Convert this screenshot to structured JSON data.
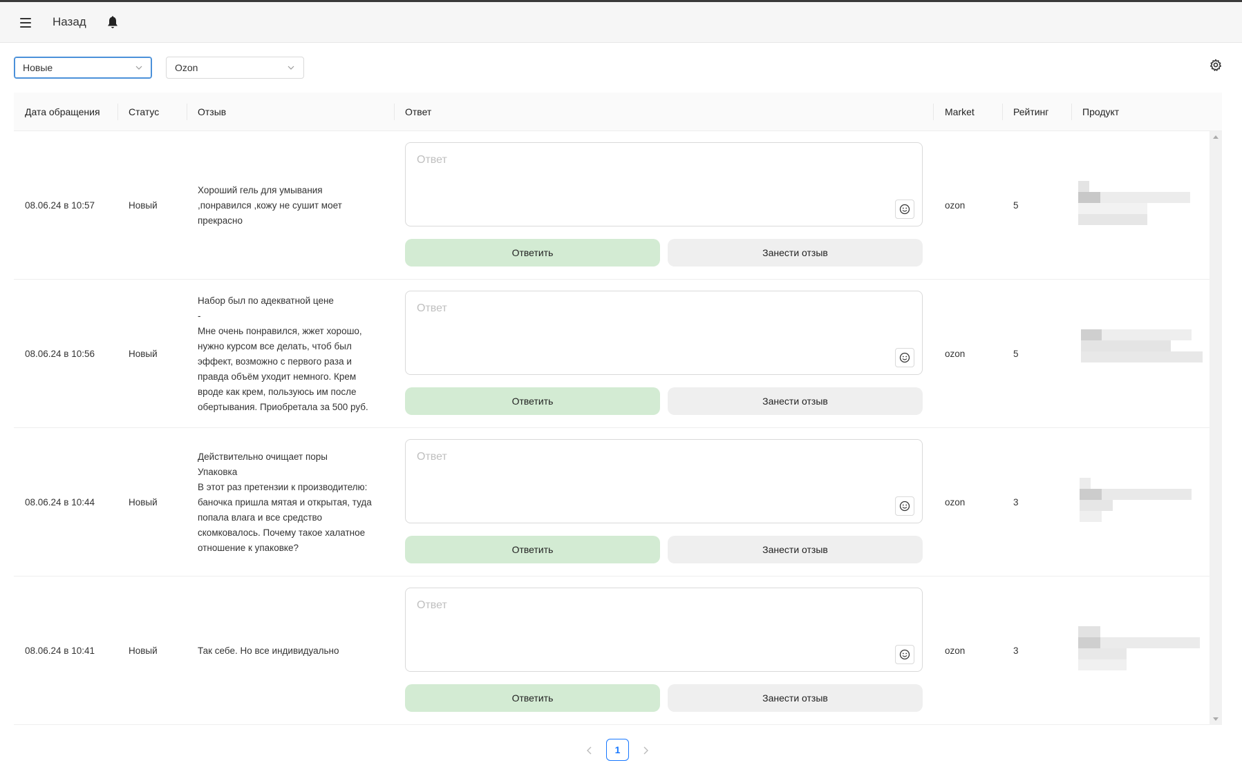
{
  "header": {
    "back_label": "Назад"
  },
  "filters": {
    "status_value": "Новые",
    "market_value": "Ozon"
  },
  "table": {
    "columns": {
      "date": "Дата обращения",
      "status": "Статус",
      "review": "Отзыв",
      "answer": "Ответ",
      "market": "Market",
      "rating": "Рейтинг",
      "product": "Продукт"
    },
    "answer_placeholder": "Ответ",
    "reply_label": "Ответить",
    "save_label": "Занести отзыв",
    "rows": [
      {
        "date": "08.06.24 в 10:57",
        "status": "Новый",
        "review": "Хороший гель для умывания\n,понравился ,кожу не сушит моет\nпрекрасно",
        "market": "ozon",
        "rating": "5"
      },
      {
        "date": "08.06.24 в 10:56",
        "status": "Новый",
        "review": "Набор был по адекватной цене\n-\nМне очень понравился, жжет хорошо,\nнужно курсом все делать, чтоб был\nэффект, возможно с первого раза и\nправда объём уходит немного. Крем\nвроде как крем, пользуюсь им после\nобертывания. Приобретала за 500 руб.",
        "market": "ozon",
        "rating": "5"
      },
      {
        "date": "08.06.24 в 10:44",
        "status": "Новый",
        "review": "Действительно очищает поры\nУпаковка\nВ этот раз претензии к производителю:\nбаночка пришла мятая и открытая, туда\nпопала влага и все средство\nскомковалось. Почему такое халатное\nотношение к упаковке?",
        "market": "ozon",
        "rating": "3"
      },
      {
        "date": "08.06.24 в 10:41",
        "status": "Новый",
        "review": "Так себе. Но все индивидуально",
        "market": "ozon",
        "rating": "3"
      }
    ]
  },
  "pagination": {
    "current_page": "1"
  }
}
